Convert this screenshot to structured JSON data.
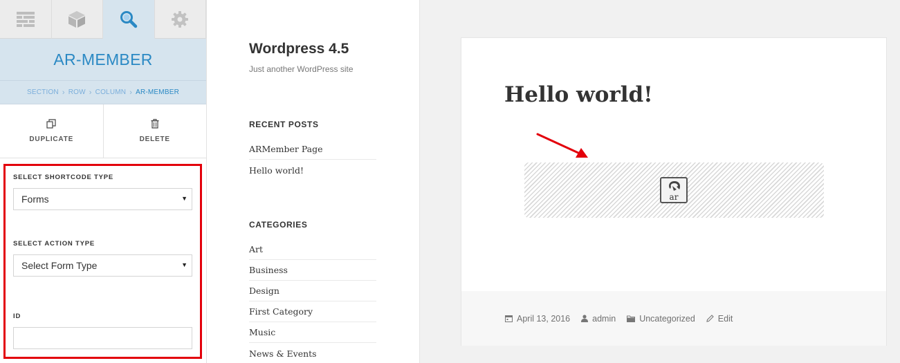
{
  "editor": {
    "tabs": [
      {
        "icon": "layout-icon",
        "active": false
      },
      {
        "icon": "cube-icon",
        "active": false
      },
      {
        "icon": "search-icon",
        "active": true
      },
      {
        "icon": "gear-icon",
        "active": false
      }
    ],
    "module_title": "AR-MEMBER",
    "breadcrumb": [
      "SECTION",
      "ROW",
      "COLUMN",
      "AR-MEMBER"
    ],
    "actions": {
      "duplicate": "DUPLICATE",
      "delete": "DELETE"
    },
    "fields": {
      "shortcode_label": "SELECT SHORTCODE TYPE",
      "shortcode_value": "Forms",
      "action_label": "SELECT ACTION TYPE",
      "action_value": "Select Form Type",
      "id_label": "ID",
      "id_value": ""
    },
    "colors": {
      "accent": "#2b89c4",
      "highlight_border": "#e3000b",
      "panel_header_bg": "#d6e4ee"
    }
  },
  "site": {
    "title": "Wordpress 4.5",
    "description": "Just another WordPress site",
    "recent_posts_title": "RECENT POSTS",
    "recent_posts": [
      "ARMember Page",
      "Hello world!"
    ],
    "categories_title": "CATEGORIES",
    "categories": [
      "Art",
      "Business",
      "Design",
      "First Category",
      "Music",
      "News & Events"
    ]
  },
  "post": {
    "title": "Hello world!",
    "shortcode_logo_text": "ar",
    "date": "April 13, 2016",
    "author": "admin",
    "category": "Uncategorized",
    "edit": "Edit"
  }
}
